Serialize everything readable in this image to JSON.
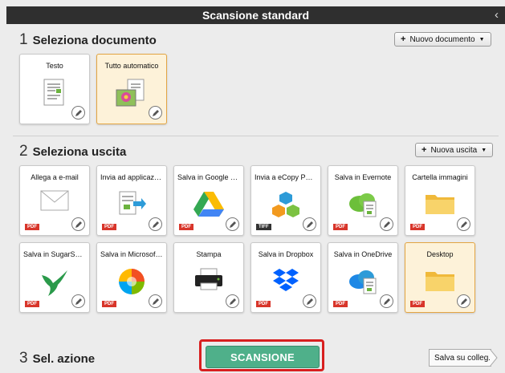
{
  "window": {
    "title": "Scansione standard",
    "back_glyph": "‹"
  },
  "section1": {
    "number": "1",
    "title": "Seleziona documento",
    "new_button": "Nuovo documento"
  },
  "documents": [
    {
      "label": "Testo",
      "icon": "text-document-icon",
      "selected": false
    },
    {
      "label": "Tutto automatico",
      "icon": "photo-document-icon",
      "selected": true
    }
  ],
  "section2": {
    "number": "2",
    "title": "Seleziona uscita",
    "new_button": "Nuova uscita"
  },
  "outputs": [
    {
      "label": "Allega a e-mail",
      "badge": "PDF",
      "icon": "envelope-icon"
    },
    {
      "label": "Invia ad applicazio...",
      "badge": "PDF",
      "icon": "send-to-app-icon"
    },
    {
      "label": "Salva in Google Dri...",
      "badge": "PDF",
      "icon": "google-drive-icon"
    },
    {
      "label": "Invia a eCopy PDF ...",
      "badge": "TIFF",
      "icon": "ecopy-icon"
    },
    {
      "label": "Salva in Evernote",
      "badge": "PDF",
      "icon": "evernote-cloud-icon"
    },
    {
      "label": "Cartella immagini",
      "badge": "PDF",
      "icon": "folder-icon"
    },
    {
      "label": "Salva in SugarSync",
      "badge": "PDF",
      "icon": "sugarsync-bird-icon"
    },
    {
      "label": "Salva in Microsoft ...",
      "badge": "PDF",
      "icon": "microsoft-ball-icon"
    },
    {
      "label": "Stampa",
      "badge": "",
      "icon": "printer-icon"
    },
    {
      "label": "Salva in Dropbox",
      "badge": "PDF",
      "icon": "dropbox-icon"
    },
    {
      "label": "Salva in OneDrive",
      "badge": "PDF",
      "icon": "onedrive-cloud-icon"
    },
    {
      "label": "Desktop",
      "badge": "PDF",
      "icon": "folder-icon",
      "selected": true
    }
  ],
  "section3": {
    "number": "3",
    "title": "Sel. azione"
  },
  "actions": {
    "scan_button": "SCANSIONE",
    "save_link": "Salva su colleg."
  }
}
